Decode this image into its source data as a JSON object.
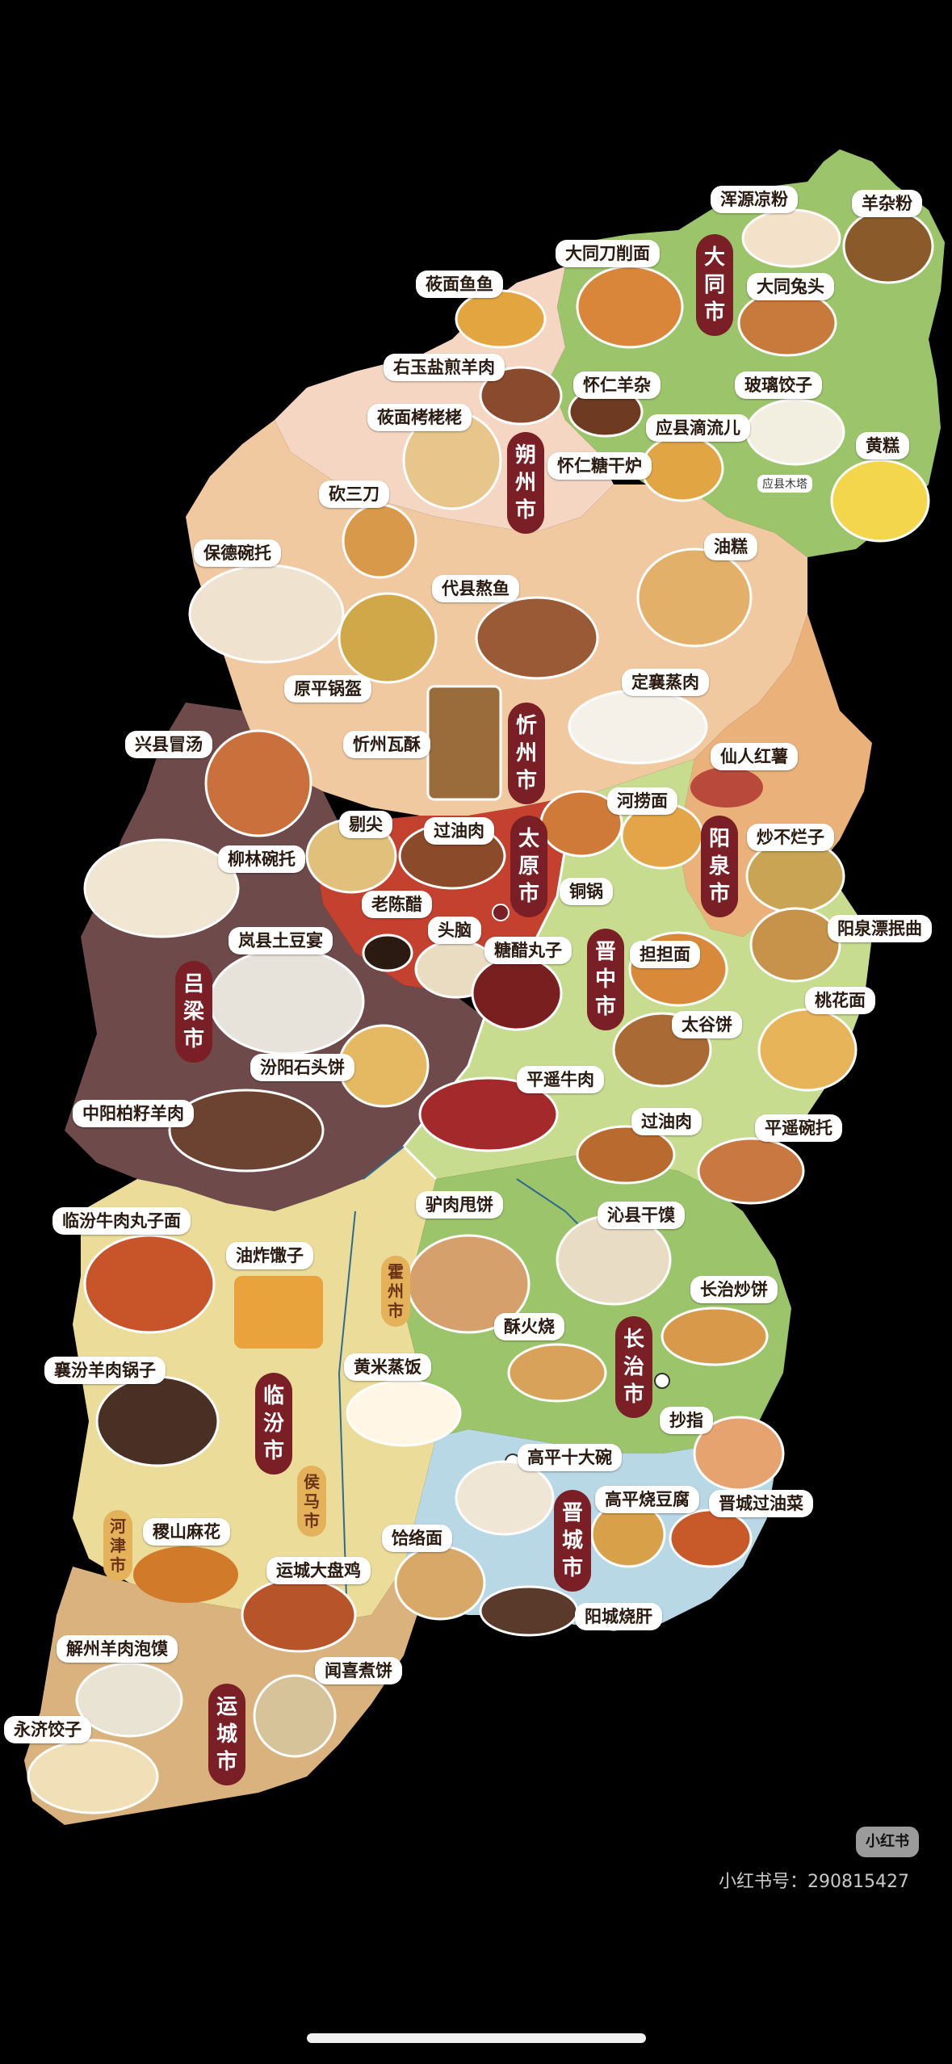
{
  "cities": {
    "datong": "大同市",
    "shuozhou": "朔州市",
    "xinzhou": "忻州市",
    "taiyuan": "太原市",
    "yangquan": "阳泉市",
    "jinzhong": "晋中市",
    "lvliang": "吕梁市",
    "linfen": "临汾市",
    "changzhi": "长治市",
    "jincheng": "晋城市",
    "yuncheng": "运城市",
    "huozhou": "霍州市",
    "houma": "侯马市",
    "hejin": "河津市"
  },
  "foods": {
    "hunyuan_liangfen": "浑源凉粉",
    "yangza_fen": "羊杂粉",
    "datong_daoxiaomian": "大同刀削面",
    "youmian_yuyu": "莜面鱼鱼",
    "datong_tutou": "大同兔头",
    "youyu_yangrou": "右玉盐煎羊肉",
    "huairen_yangza": "怀仁羊杂",
    "boli_jiaozi": "玻璃饺子",
    "youmian_kaolaolao": "莜面栲栳栳",
    "yingxian_diliur": "应县滴流儿",
    "huairen_tangganlu": "怀仁糖干炉",
    "huanggao": "黄糕",
    "kan_san_dao": "砍三刀",
    "baode_wantuo": "保德碗托",
    "daixian_aoyu": "代县熬鱼",
    "yougao": "油糕",
    "yuanping_guokui": "原平锅盔",
    "dingxiang_zhengrou": "定襄蒸肉",
    "xingxian_maotang": "兴县冒汤",
    "xinzhou_wasu": "忻州瓦酥",
    "xianren_hongshu": "仙人红薯",
    "liujian": "剔尖",
    "guoyourou": "过油肉",
    "helaomian": "河捞面",
    "chaobulanzi": "炒不烂子",
    "liulin_wantuo": "柳林碗托",
    "laochencu": "老陈醋",
    "tongguo": "铜锅",
    "lanxian_tudouyan": "岚县土豆宴",
    "tounao": "头脑",
    "tangcu_wanzi": "糖醋丸子",
    "dandanmian": "担担面",
    "yangquan_piaojinqu": "阳泉漂抿曲",
    "taigu_bing": "太谷饼",
    "taohuamian": "桃花面",
    "fenyang_shitoubing": "汾阳石头饼",
    "pingyao_niurou": "平遥牛肉",
    "zhongyang_bozi_yangrou": "中阳柏籽羊肉",
    "guoyourou_2": "过油肉",
    "pingyao_wantuo": "平遥碗托",
    "linfen_niurou_wanzimian": "临汾牛肉丸子面",
    "lvrou_shuaibing": "驴肉甩饼",
    "qinxian_ganmo": "沁县干馍",
    "youzha_sanzi": "油炸馓子",
    "changzhi_chaobing": "长治炒饼",
    "xiangfen_yangrou_guozi": "襄汾羊肉锅子",
    "suhuoshao": "酥火烧",
    "huangmi_zhengfan": "黄米蒸饭",
    "chaozhi": "抄指",
    "gaoping_shidawan": "高平十大碗",
    "gaoping_shaodoufu": "高平烧豆腐",
    "jincheng_guoyoucai": "晋城过油菜",
    "jishan_mahua": "稷山麻花",
    "helemian": "饸络面",
    "yuncheng_dapanji": "运城大盘鸡",
    "yangcheng_shaogan": "阳城烧肝",
    "xiezhou_yangrou_paomo": "解州羊肉泡馍",
    "wenxi_zhubing": "闻喜煮饼",
    "yongji_jiaozi": "永济饺子"
  },
  "notes": {
    "yingxian_muta": "应县木塔"
  },
  "watermark": {
    "logo": "小红书",
    "id": "小红书号：290815427"
  },
  "colors": {
    "background": "#000000",
    "city_badge": "#7a1f25",
    "region_green": "#9cc46b",
    "region_peach": "#f1c9a1",
    "region_orange": "#eab27a",
    "region_brown": "#6e4b4a",
    "region_light_green": "#c7dc8f",
    "region_yellow": "#ecdc9a",
    "region_blue": "#b9d8e6",
    "region_tan": "#d9b27d",
    "region_red": "#c5412f"
  }
}
